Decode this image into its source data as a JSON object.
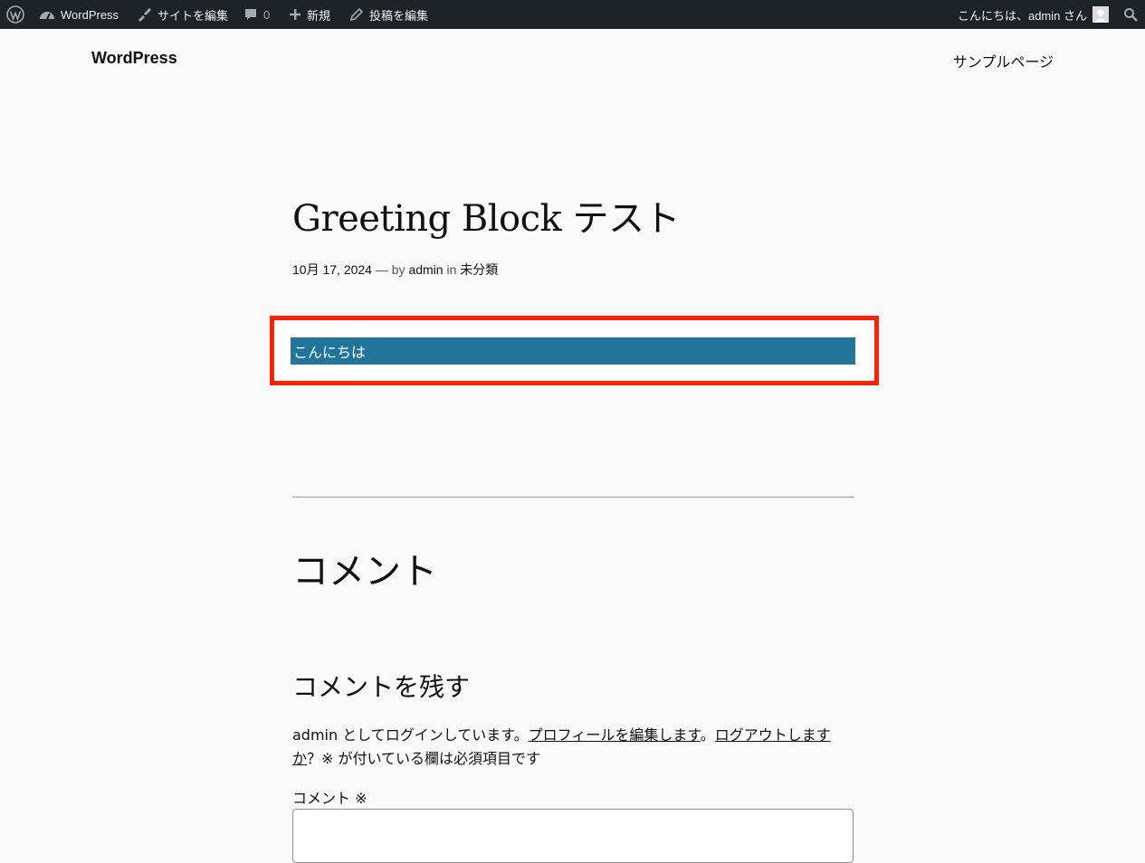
{
  "admin_bar": {
    "site_name": "WordPress",
    "edit_site": "サイトを編集",
    "comment_count": "0",
    "new": "新規",
    "edit_post": "投稿を編集",
    "greeting": "こんにちは、admin さん"
  },
  "header": {
    "site_title": "WordPress",
    "nav_item": "サンプルページ"
  },
  "post": {
    "title": "Greeting Block テスト",
    "date": "10月 17, 2024",
    "dash": "—",
    "by": "by",
    "author": "admin",
    "in": "in",
    "category": "未分類",
    "greeting_block_text": "こんにちは"
  },
  "comments": {
    "heading": "コメント",
    "reply_heading": "コメントを残す",
    "logged_in_prefix": "admin としてログインしています。",
    "edit_profile_link": "プロフィールを編集します",
    "period": "。",
    "logout_link": "ログアウトしますか",
    "required_note": "？※ が付いている欄は必須項目です",
    "comment_label": "コメント ※"
  },
  "colors": {
    "admin_bar_bg": "#1d2327",
    "greeting_block_bg": "#21759b",
    "highlight_border": "#ff2200",
    "page_bg": "#f9f9f9"
  },
  "icons": [
    "wordpress-logo-icon",
    "dashboard-icon",
    "brush-icon",
    "comment-bubble-icon",
    "plus-icon",
    "pencil-icon",
    "user-avatar-icon",
    "search-icon"
  ]
}
